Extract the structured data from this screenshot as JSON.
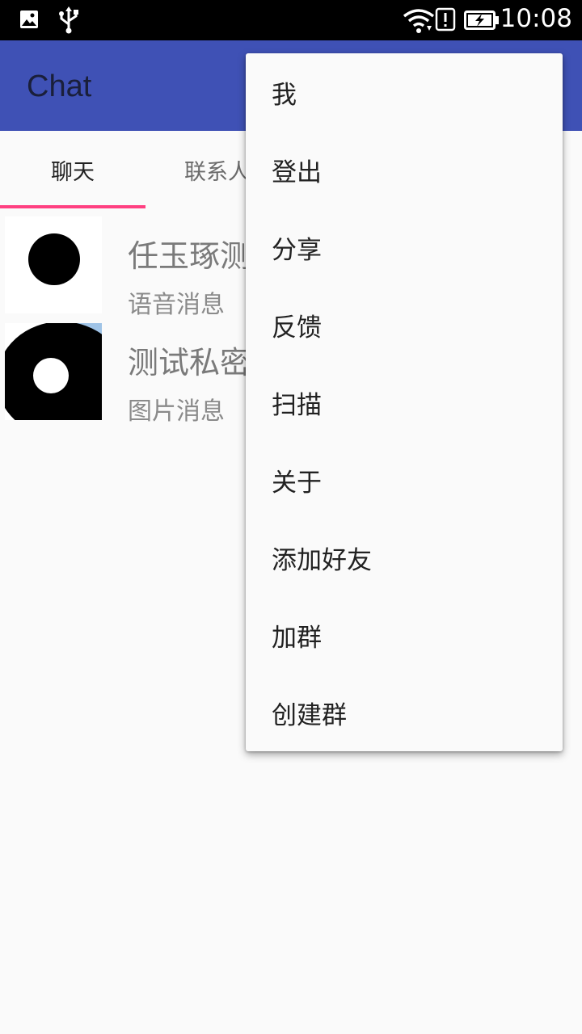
{
  "status_bar": {
    "time": "10:08",
    "icons": [
      "gallery-icon",
      "usb-icon",
      "wifi-icon",
      "alert-icon",
      "battery-charging-icon"
    ]
  },
  "app_bar": {
    "title": "Chat",
    "color": "#3f51b5"
  },
  "tabs": [
    {
      "label": "聊天",
      "selected": true
    },
    {
      "label": "联系人",
      "selected": false
    }
  ],
  "accent_color": "#ff4081",
  "conversations": [
    {
      "name": "任玉琢测",
      "preview": "语音消息"
    },
    {
      "name": "测试私密",
      "preview": "图片消息"
    }
  ],
  "menu": {
    "items": [
      {
        "label": "我"
      },
      {
        "label": "登出"
      },
      {
        "label": "分享"
      },
      {
        "label": "反馈"
      },
      {
        "label": "扫描"
      },
      {
        "label": "关于"
      },
      {
        "label": "添加好友"
      },
      {
        "label": "加群"
      },
      {
        "label": "创建群"
      }
    ]
  }
}
